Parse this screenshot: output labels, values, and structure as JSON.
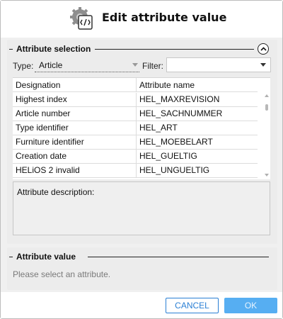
{
  "dialog": {
    "title": "Edit attribute value",
    "icon": "gear-code-icon"
  },
  "selection": {
    "legend": "Attribute selection",
    "collapse_icon": "chevron-up-circle-icon",
    "type_label": "Type:",
    "type_value": "Article",
    "filter_label": "Filter:",
    "filter_value": ""
  },
  "table": {
    "headers": [
      "Designation",
      "Attribute name"
    ],
    "rows": [
      [
        "Highest index",
        "HEL_MAXREVISION"
      ],
      [
        "Article number",
        "HEL_SACHNUMMER"
      ],
      [
        "Type identifier",
        "HEL_ART"
      ],
      [
        "Furniture identifier",
        "HEL_MOEBELART"
      ],
      [
        "Creation date",
        "HEL_GUELTIG"
      ],
      [
        "HELiOS 2 invalid",
        "HEL_UNGUELTIG"
      ]
    ]
  },
  "description": {
    "label": "Attribute description:"
  },
  "value": {
    "legend": "Attribute value",
    "hint": "Please select an attribute."
  },
  "buttons": {
    "cancel": "CANCEL",
    "ok": "OK"
  },
  "colors": {
    "accent": "#2a7fd4",
    "ok_bg": "#56aef2"
  }
}
